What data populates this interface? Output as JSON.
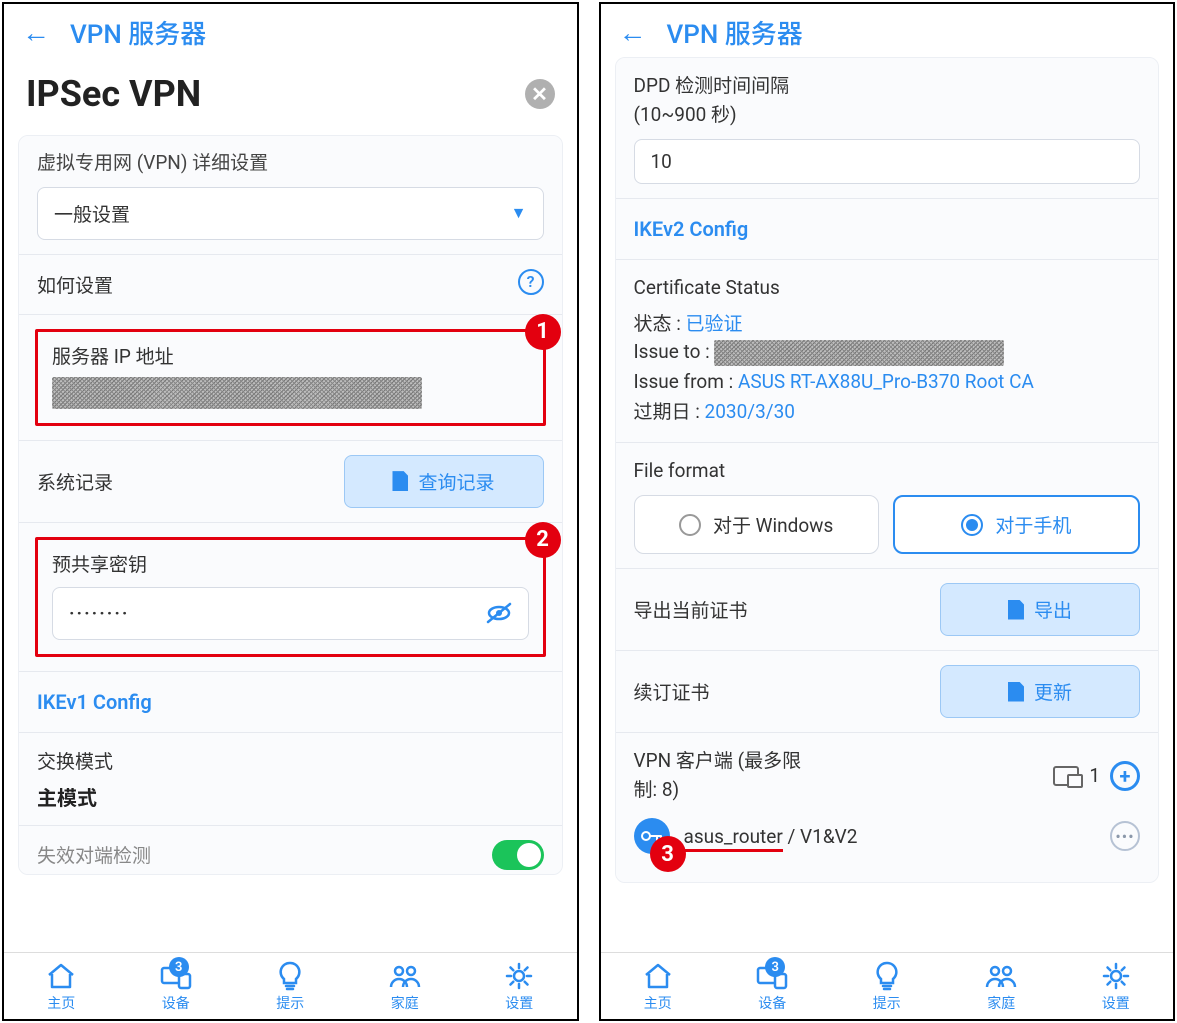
{
  "left": {
    "header": {
      "title": "VPN 服务器"
    },
    "page_title": "IPSec VPN",
    "detail_label": "虚拟专用网 (VPN) 详细设置",
    "select_value": "一般设置",
    "howto_label": "如何设置",
    "server_ip_label": "服务器 IP 地址",
    "syslog_label": "系统记录",
    "query_button": "查询记录",
    "psk_label": "预共享密钥",
    "psk_value": "········",
    "ikev1_title": "IKEv1 Config",
    "exchange_mode_label": "交换模式",
    "exchange_mode_value": "主模式",
    "dpd_label_partial": "失效对端检测",
    "badges": {
      "b1": "1",
      "b2": "2"
    }
  },
  "right": {
    "header": {
      "title": "VPN 服务器"
    },
    "dpd_interval_label": "DPD 检测时间间隔",
    "dpd_interval_unit": "(10~900 秒)",
    "dpd_interval_value": "10",
    "ikev2_title": "IKEv2 Config",
    "cert_status_title": "Certificate Status",
    "status_label": "状态 : ",
    "status_value": "已验证",
    "issue_to_label": "Issue to : ",
    "issue_from_label": "Issue from : ",
    "issue_from_value": "ASUS RT-AX88U_Pro-B370 Root CA",
    "expire_label": "过期日 : ",
    "expire_value": "2030/3/30",
    "file_format_label": "File format",
    "radio_windows": "对于 Windows",
    "radio_phone": "对于手机",
    "export_label": "导出当前证书",
    "export_button": "导出",
    "renew_label": "续订证书",
    "renew_button": "更新",
    "client_header_a": "VPN 客户端 (最多限",
    "client_header_b": "制:  8)",
    "client_count": "1",
    "client_name": "asus_router",
    "client_suffix": " / V1&V2",
    "badges": {
      "b3": "3"
    }
  },
  "nav": {
    "home": "主页",
    "devices": "设备",
    "hints": "提示",
    "family": "家庭",
    "settings": "设置",
    "badge": "3"
  }
}
